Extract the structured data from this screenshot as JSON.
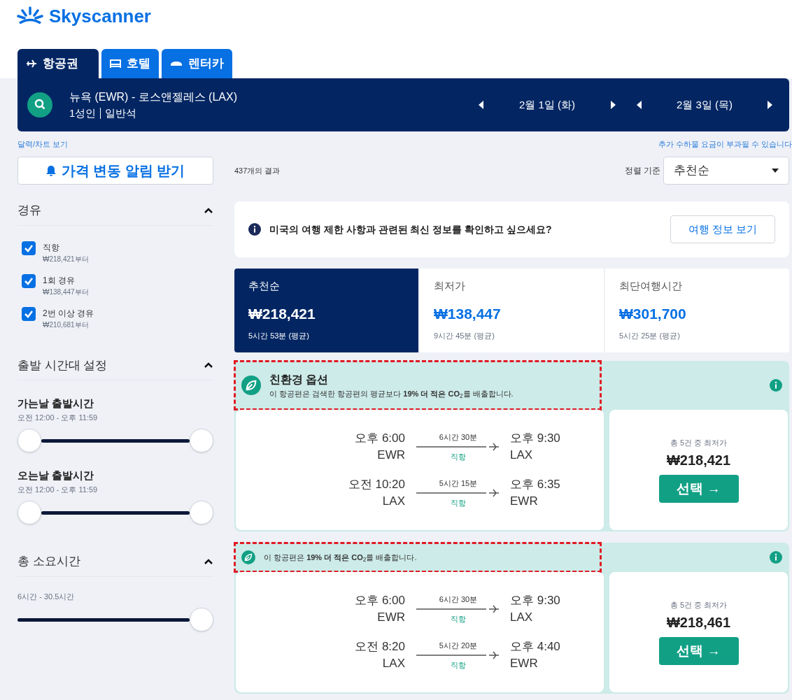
{
  "logo": {
    "text": "Skyscanner"
  },
  "tabs": [
    {
      "label": "항공권",
      "selected": true
    },
    {
      "label": "호텔",
      "selected": false
    },
    {
      "label": "렌터카",
      "selected": false
    }
  ],
  "search": {
    "route": "뉴욕 (EWR) - 로스앤젤레스 (LAX)",
    "passengers": "1성인",
    "cabin": "일반석",
    "depart_date": "2월 1일 (화)",
    "return_date": "2월 3일 (목)"
  },
  "calendar_link": "달력/차트 보기",
  "fee_notice": "추가 수하물 요금이 부과될 수 있습니다",
  "price_alert_button": "가격 변동 알림 받기",
  "filters": {
    "stops": {
      "title": "경유",
      "expanded": true,
      "options": [
        {
          "label": "직항",
          "price": "₩218,421부터",
          "checked": true
        },
        {
          "label": "1회 경유",
          "price": "₩138,447부터",
          "checked": true
        },
        {
          "label": "2번 이상 경유",
          "price": "₩210,681부터",
          "checked": true
        }
      ]
    },
    "departure_times": {
      "title": "출발 시간대 설정",
      "expanded": true,
      "sliders": [
        {
          "label": "가는날 출발시간",
          "range": "오전 12:00 - 오후 11:59",
          "level": 1
        },
        {
          "label": "오는날 출발시간",
          "range": "오전 12:00 - 오후 11:59",
          "level": 1
        }
      ]
    },
    "duration": {
      "title": "총 소요시간",
      "expanded": true,
      "range": "6시간 - 30.5시간",
      "level": 1
    }
  },
  "results_count": "437개의 결과",
  "sort": {
    "label": "정렬 기준",
    "value": "추천순"
  },
  "info_banner": {
    "text": "미국의 여행 제한 사항과 관련된 최신 정보를 확인하고 싶으세요?",
    "button": "여행 정보 보기"
  },
  "sort_tabs": [
    {
      "label": "추천순",
      "price": "₩218,421",
      "duration": "5시간 53분 (평균)",
      "selected": true
    },
    {
      "label": "최저가",
      "price": "₩138,447",
      "duration": "9시간 45분 (평균)",
      "selected": false
    },
    {
      "label": "최단여행시간",
      "price": "₩301,700",
      "duration": "5시간 25분 (평균)",
      "selected": false
    }
  ],
  "flights": [
    {
      "eco": {
        "kind": "full",
        "title": "친환경 옵션",
        "text": "이 항공편은 검색한 항공편의 평균보다 **19% 더 적은 CO**$_{2}$를 배출합니다.",
        "highlighted": true
      },
      "legs": [
        {
          "depart_time": "오후 6:00",
          "depart_airport": "EWR",
          "duration": "6시간 30분",
          "stops": "직항",
          "arrive_time": "오후 9:30",
          "arrive_airport": "LAX"
        },
        {
          "depart_time": "오전 10:20",
          "depart_airport": "LAX",
          "duration": "5시간 15분",
          "stops": "직항",
          "arrive_time": "오후 6:35",
          "arrive_airport": "EWR"
        }
      ],
      "deal_note": "총 5건 중 최저가",
      "price": "₩218,421",
      "select_button": "선택 →"
    },
    {
      "eco": {
        "kind": "compact",
        "text": "이 항공편은 **19% 더 적은 CO**$_{2}$를 배출합니다.",
        "highlighted": true
      },
      "legs": [
        {
          "depart_time": "오후 6:00",
          "depart_airport": "EWR",
          "duration": "6시간 30분",
          "stops": "직항",
          "arrive_time": "오후 9:30",
          "arrive_airport": "LAX"
        },
        {
          "depart_time": "오전 8:20",
          "depart_airport": "LAX",
          "duration": "5시간 20분",
          "stops": "직항",
          "arrive_time": "오후 4:40",
          "arrive_airport": "EWR"
        }
      ],
      "deal_note": "총 5건 중 최저가",
      "price": "₩218,461",
      "select_button": "선택 →"
    }
  ]
}
